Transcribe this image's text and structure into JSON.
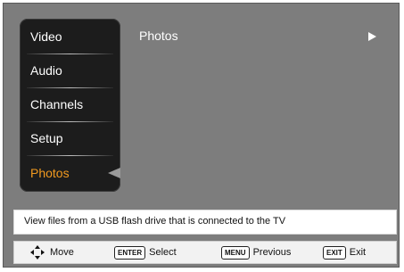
{
  "menu": {
    "items": [
      {
        "label": "Video"
      },
      {
        "label": "Audio"
      },
      {
        "label": "Channels"
      },
      {
        "label": "Setup"
      },
      {
        "label": "Photos",
        "active": true
      }
    ]
  },
  "content": {
    "item_label": "Photos",
    "arrow_icon": "right-arrow-icon"
  },
  "description": "View files from a USB flash drive that is connected to the TV",
  "hints": {
    "move_label": "Move",
    "move_icon": "dpad-icon",
    "enter_key": "ENTER",
    "enter_label": "Select",
    "menu_key": "MENU",
    "menu_label": "Previous",
    "exit_key": "EXIT",
    "exit_label": "Exit"
  },
  "colors": {
    "active": "#f29a1f",
    "menu_bg": "#1c1c1c",
    "panel_bg": "#7d7d7d"
  }
}
